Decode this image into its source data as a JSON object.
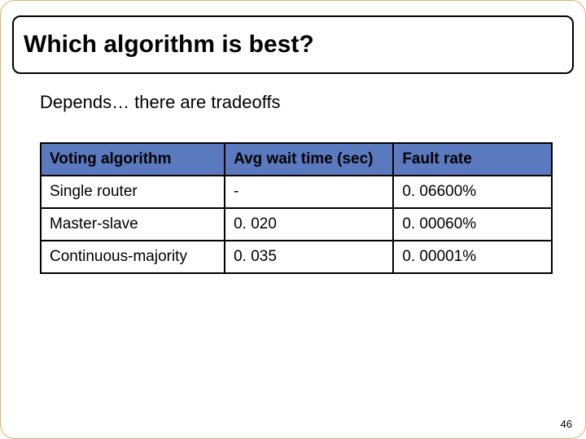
{
  "slide": {
    "title": "Which algorithm is best?",
    "lead": "Depends… there are tradeoffs",
    "page_number": "46"
  },
  "table": {
    "headers": [
      "Voting algorithm",
      "Avg wait time (sec)",
      "Fault rate"
    ],
    "rows": [
      {
        "algo": "Single router",
        "wait": "-",
        "fault": "0. 06600%"
      },
      {
        "algo": "Master-slave",
        "wait": "0. 020",
        "fault": "0. 00060%"
      },
      {
        "algo": "Continuous-majority",
        "wait": "0. 035",
        "fault": "0. 00001%"
      }
    ]
  },
  "chart_data": {
    "type": "table",
    "title": "Which algorithm is best?",
    "columns": [
      "Voting algorithm",
      "Avg wait time (sec)",
      "Fault rate"
    ],
    "rows": [
      [
        "Single router",
        null,
        0.066
      ],
      [
        "Master-slave",
        0.02,
        0.0006
      ],
      [
        "Continuous-majority",
        0.035,
        1e-05
      ]
    ],
    "units": {
      "Avg wait time (sec)": "sec",
      "Fault rate": "%"
    }
  }
}
